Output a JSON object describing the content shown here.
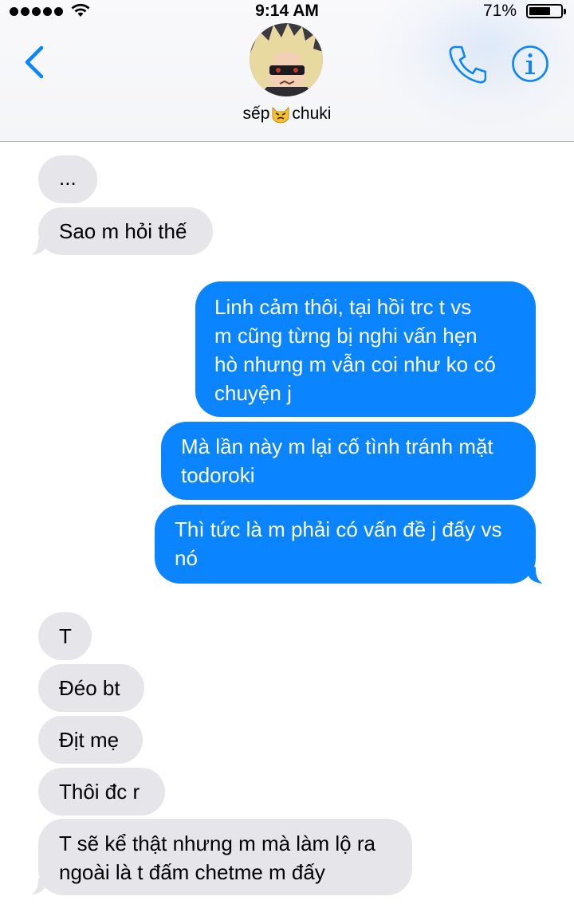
{
  "status_bar": {
    "time": "9:14 AM",
    "battery_percent": "71%",
    "battery_level": 0.71
  },
  "header": {
    "contact_name_before": "sếp",
    "contact_name_after": "chuki",
    "contact_emoji_icon": "angry-cat-icon"
  },
  "messages": [
    {
      "direction": "incoming",
      "text": "..."
    },
    {
      "direction": "incoming",
      "text": "Sao m hỏi thế"
    },
    {
      "direction": "outgoing",
      "lines": [
        "Linh cảm thôi, tại hồi trc t vs",
        "m cũng từng bị nghi vấn hẹn",
        "hò nhưng m vẫn coi như ko có",
        "chuyện j"
      ]
    },
    {
      "direction": "outgoing",
      "lines": [
        "Mà lần này m lại cố tình tránh mặt",
        "todoroki"
      ]
    },
    {
      "direction": "outgoing",
      "lines": [
        "Thì tức là m phải có vấn đề j đấy vs",
        "nó"
      ]
    },
    {
      "direction": "incoming",
      "text": "T"
    },
    {
      "direction": "incoming",
      "text": "Đéo bt"
    },
    {
      "direction": "incoming",
      "text": "Địt mẹ"
    },
    {
      "direction": "incoming",
      "text": "Thôi đc r"
    },
    {
      "direction": "incoming",
      "lines": [
        "T sẽ kể thật nhưng m mà làm lộ ra",
        "ngoài là t đấm chetme m đấy"
      ]
    }
  ],
  "colors": {
    "accent": "#0b84ff",
    "incoming_bubble": "#e5e5ea",
    "outgoing_text": "#ffffff"
  }
}
